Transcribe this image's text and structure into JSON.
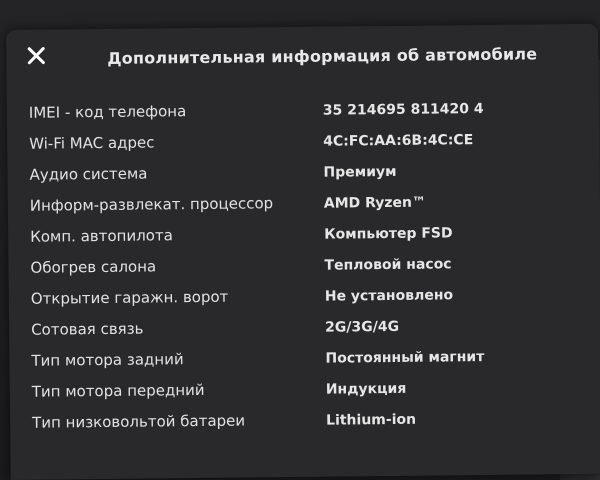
{
  "dialog": {
    "title": "Дополнительная информация об автомобиле",
    "close_icon": "close-icon"
  },
  "rows": [
    {
      "label": "IMEI - код телефона",
      "value": "35 214695 811420 4"
    },
    {
      "label": "Wi-Fi MAC адрес",
      "value": "4C:FC:AA:6B:4C:CE"
    },
    {
      "label": "Аудио система",
      "value": "Премиум"
    },
    {
      "label": "Информ-развлекат. процессор",
      "value": "AMD Ryzen™"
    },
    {
      "label": "Комп. автопилота",
      "value": "Компьютер FSD"
    },
    {
      "label": "Обогрев салона",
      "value": "Тепловой насос"
    },
    {
      "label": "Открытие гаражн. ворот",
      "value": "Не установлено"
    },
    {
      "label": "Сотовая связь",
      "value": "2G/3G/4G"
    },
    {
      "label": "Тип мотора задний",
      "value": "Постоянный магнит"
    },
    {
      "label": "Тип мотора передний",
      "value": "Индукция"
    },
    {
      "label": "Тип низковольтой батареи",
      "value": "Lithium-ion"
    }
  ]
}
